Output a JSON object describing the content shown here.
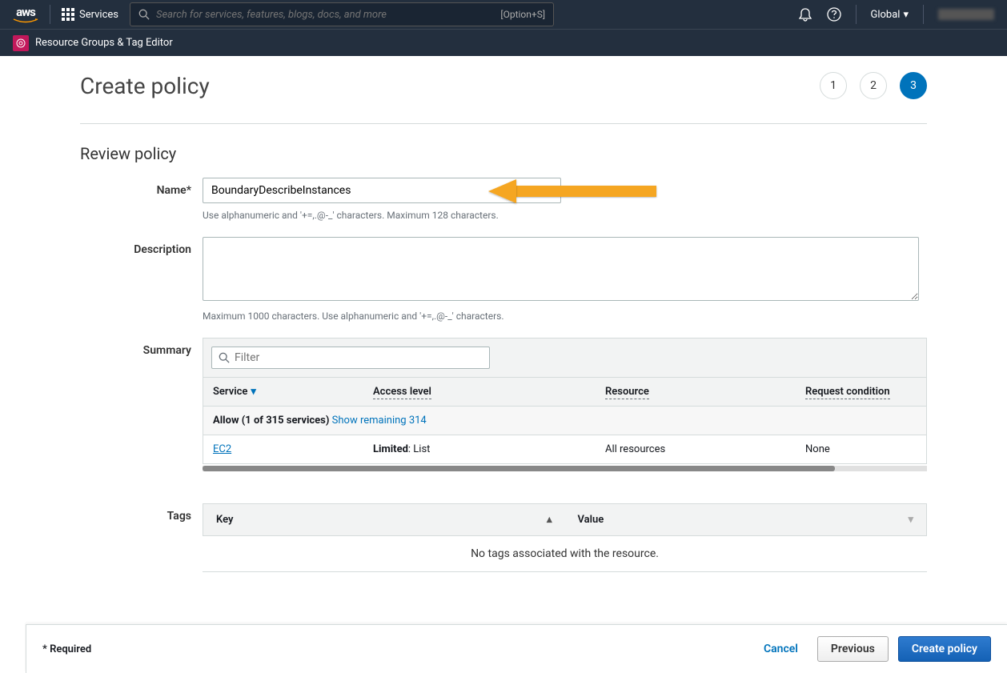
{
  "nav": {
    "services_label": "Services",
    "search_placeholder": "Search for services, features, blogs, docs, and more",
    "search_shortcut": "[Option+S]",
    "region": "Global",
    "subnav": "Resource Groups & Tag Editor"
  },
  "page": {
    "title": "Create policy",
    "steps": [
      "1",
      "2",
      "3"
    ],
    "active_step": 3,
    "section_title": "Review policy"
  },
  "form": {
    "name_label": "Name*",
    "name_value": "BoundaryDescribeInstances",
    "name_hint": "Use alphanumeric and '+=,.@-_' characters. Maximum 128 characters.",
    "desc_label": "Description",
    "desc_value": "",
    "desc_hint": "Maximum 1000 characters. Use alphanumeric and '+=,.@-_' characters.",
    "summary_label": "Summary",
    "tags_label": "Tags"
  },
  "summary": {
    "filter_placeholder": "Filter",
    "columns": {
      "service": "Service",
      "access": "Access level",
      "resource": "Resource",
      "condition": "Request condition"
    },
    "allow_text_prefix": "Allow ",
    "allow_text_count": "(1 of 315 services)",
    "show_remaining": "Show remaining 314",
    "row": {
      "service": "EC2",
      "access_bold": "Limited",
      "access_rest": ": List",
      "resource": "All resources",
      "condition": "None"
    }
  },
  "tags": {
    "key_header": "Key",
    "value_header": "Value",
    "empty": "No tags associated with the resource."
  },
  "footer": {
    "required": "* Required",
    "cancel": "Cancel",
    "previous": "Previous",
    "create": "Create policy"
  }
}
